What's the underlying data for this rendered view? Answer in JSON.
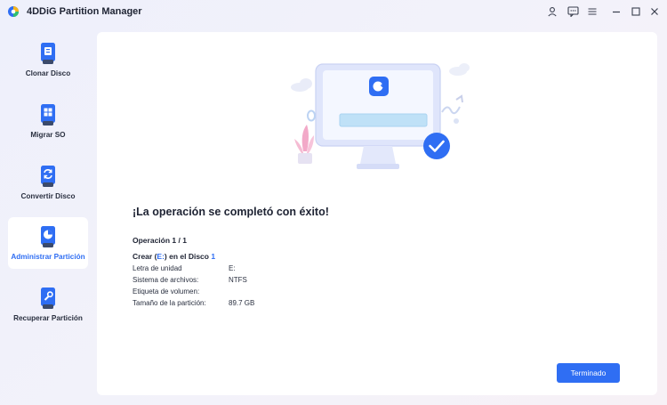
{
  "app": {
    "title": "4DDiG Partition Manager"
  },
  "titlebar": {
    "icons": [
      "user-icon",
      "feedback-icon",
      "menu-icon",
      "minimize-icon",
      "maximize-icon",
      "close-icon"
    ]
  },
  "sidebar": {
    "items": [
      {
        "label": "Clonar Disco",
        "icon": "clone-disk-icon",
        "active": false
      },
      {
        "label": "Migrar SO",
        "icon": "migrate-os-icon",
        "active": false
      },
      {
        "label": "Convertir Disco",
        "icon": "convert-disk-icon",
        "active": false
      },
      {
        "label": "Administrar Partición",
        "icon": "manage-partition-icon",
        "active": true
      },
      {
        "label": "Recuperar Partición",
        "icon": "recover-partition-icon",
        "active": false
      }
    ]
  },
  "main": {
    "success_title": "¡La operación se completó con éxito!",
    "operation_count": "Operación 1 / 1",
    "operation": {
      "prefix": "Crear (",
      "drive": "E:",
      "middle": ") en el Disco ",
      "disk": "1"
    },
    "details": [
      {
        "label": "Letra de unidad",
        "value": "E:"
      },
      {
        "label": "Sistema de archivos:",
        "value": "NTFS"
      },
      {
        "label": "Etiqueta de volumen:",
        "value": ""
      },
      {
        "label": "Tamaño de la partición:",
        "value": "89.7 GB"
      }
    ],
    "done_button": "Terminado"
  },
  "colors": {
    "accent": "#2f6ef3",
    "panel": "#ffffff",
    "text": "#1e2333"
  }
}
